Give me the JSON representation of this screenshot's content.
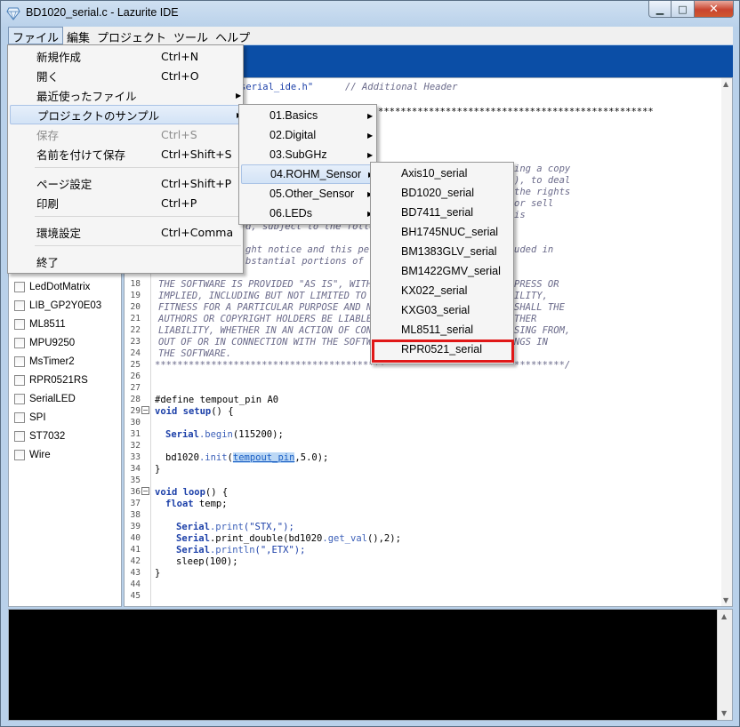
{
  "window": {
    "title": "BD1020_serial.c - Lazurite IDE"
  },
  "caption_buttons": {
    "minimize": "▁",
    "maximize": "□",
    "close": "✕"
  },
  "menubar": [
    "ファイル",
    "編集",
    "プロジェクト",
    "ツール",
    "ヘルプ"
  ],
  "file_menu": [
    {
      "label": "新規作成",
      "shortcut": "Ctrl+N"
    },
    {
      "label": "開く",
      "shortcut": "Ctrl+O"
    },
    {
      "label": "最近使ったファイル",
      "shortcut": "",
      "submenu": true
    },
    {
      "label": "プロジェクトのサンプル",
      "shortcut": "",
      "submenu": true,
      "highlighted": true
    },
    {
      "label": "保存",
      "shortcut": "Ctrl+S",
      "disabled": true
    },
    {
      "label": "名前を付けて保存",
      "shortcut": "Ctrl+Shift+S"
    },
    {
      "label": "ページ設定",
      "shortcut": "Ctrl+Shift+P"
    },
    {
      "label": "印刷",
      "shortcut": "Ctrl+P"
    },
    {
      "label": "環境設定",
      "shortcut": "Ctrl+Comma"
    },
    {
      "label": "終了",
      "shortcut": ""
    }
  ],
  "samples_menu": [
    "01.Basics",
    "02.Digital",
    "03.SubGHz",
    "04.ROHM_Sensor",
    "05.Other_Sensor",
    "06.LEDs"
  ],
  "rohm_menu": [
    "Axis10_serial",
    "BD1020_serial",
    "BD7411_serial",
    "BH1745NUC_serial",
    "BM1383GLV_serial",
    "BM1422GMV_serial",
    "KX022_serial",
    "KXG03_serial",
    "ML8511_serial",
    "RPR0521_serial"
  ],
  "libraries": [
    "LedDotMatrix",
    "LIB_GP2Y0E03",
    "ML8511",
    "MPU9250",
    "MsTimer2",
    "RPR0521RS",
    "SerialLED",
    "SPI",
    "ST7032",
    "Wire"
  ],
  "editor": {
    "line_numbers": [
      "18",
      "19",
      "20",
      "21",
      "22",
      "23",
      "24",
      "25",
      "26",
      "27",
      "28",
      "29",
      "30",
      "31",
      "32",
      "33",
      "34",
      "35",
      "36",
      "37",
      "38",
      "39",
      "40",
      "41",
      "42",
      "43",
      "44",
      "45"
    ],
    "top_fragments": {
      "include": "serial_ide.h\"",
      "include_comment": "// Additional Header",
      "stars": "*************************************************",
      "r1": "ing a copy",
      "r2": "), to deal",
      "r3": "the rights",
      "r4": "or sell",
      "r5": "is",
      "r6": "d, subject to the follo",
      "r7": "ght notice and this perm",
      "r8": "uded in",
      "r9": "bstantial portions of th"
    },
    "license": {
      "l18a": "THE SOFTWARE IS PROVIDED \"AS IS\", WITHOU",
      "l18b": "PRESS OR",
      "l19a": "IMPLIED, INCLUDING BUT NOT LIMITED TO TH",
      "l19b": "ILITY,",
      "l20a": "FITNESS FOR A PARTICULAR PURPOSE AND NON",
      "l20b": "SHALL THE",
      "l21a": "AUTHORS OR COPYRIGHT HOLDERS BE LIABLE F",
      "l21b": "THER",
      "l22a": "LIABILITY, WHETHER IN AN ACTION OF CONTR",
      "l22b": "SING FROM,",
      "l23a": "OUT OF OR IN CONNECTION WITH THE SOFTWAR",
      "l23b": "NGS IN",
      "l24": "THE SOFTWARE.",
      "l25a": "*****************************************",
      "l25b": "*********/"
    },
    "code": {
      "define_kw": "#define",
      "define_rest": " tempout_pin A0",
      "void": "void",
      "setup": "setup",
      "setup_rest": "() {",
      "serial_obj": "Serial",
      "begin_fn": ".begin",
      "begin_args": "(115200);",
      "bd_obj": "bd1020",
      "init_fn": ".init",
      "init_open": "(",
      "init_sel": "tempout_pin",
      "init_rest": ",5.0);",
      "close": "}",
      "loop": "loop",
      "loop_rest": "() {",
      "float_kw": "float",
      "float_rest": " temp;",
      "print_fn": ".print",
      "print_args": "(\"STX,\");",
      "printd": ".print_double",
      "printd_args_a": "(bd1020",
      "get_val": ".get_val",
      "printd_args_b": "(),2);",
      "println_fn": ".println",
      "println_args": "(\",ETX\");",
      "sleep": "sleep(100);"
    }
  }
}
